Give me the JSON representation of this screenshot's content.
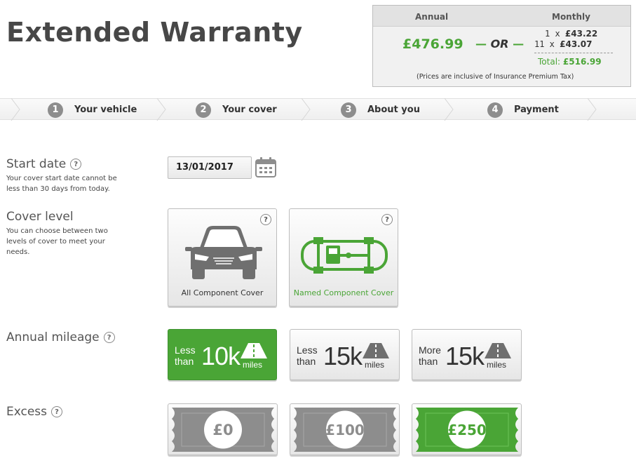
{
  "page": {
    "title": "Extended Warranty"
  },
  "prices": {
    "annual_label": "Annual",
    "monthly_label": "Monthly",
    "annual_price": "£476.99",
    "or_label": "OR",
    "monthly_line1_prefix": "1 x ",
    "monthly_line1_value": "£43.22",
    "monthly_line2_prefix": "11 x ",
    "monthly_line2_value": "£43.07",
    "total_label": "Total:",
    "total_value": "£516.99",
    "note": "(Prices are inclusive of Insurance Premium Tax)"
  },
  "steps": [
    {
      "num": "1",
      "label": "Your vehicle"
    },
    {
      "num": "2",
      "label": "Your cover"
    },
    {
      "num": "3",
      "label": "About you"
    },
    {
      "num": "4",
      "label": "Payment"
    }
  ],
  "start_date": {
    "label": "Start date",
    "help": "?",
    "desc": "Your cover start date cannot be less than 30 days from today.",
    "value": "13/01/2017",
    "icon": "calendar-icon"
  },
  "cover_level": {
    "label": "Cover level",
    "help": "?",
    "desc": "You can choose between two levels of cover to meet your needs.",
    "options": [
      {
        "caption": "All Component Cover",
        "icon": "car-front-icon",
        "help": "?"
      },
      {
        "caption": "Named Component Cover",
        "icon": "car-chassis-icon",
        "help": "?"
      }
    ]
  },
  "annual_mileage": {
    "label": "Annual mileage",
    "help": "?",
    "options": [
      {
        "line1": "Less",
        "line2": "than",
        "value": "10k",
        "unit": "miles",
        "selected": true
      },
      {
        "line1": "Less",
        "line2": "than",
        "value": "15k",
        "unit": "miles",
        "selected": false
      },
      {
        "line1": "More",
        "line2": "than",
        "value": "15k",
        "unit": "miles",
        "selected": false
      }
    ]
  },
  "excess": {
    "label": "Excess",
    "help": "?",
    "options": [
      {
        "value": "£0",
        "selected": false
      },
      {
        "value": "£100",
        "selected": false
      },
      {
        "value": "£250",
        "selected": true
      }
    ]
  },
  "colors": {
    "green": "#4aa536",
    "grey": "#8d8d8d",
    "text": "#444444"
  }
}
